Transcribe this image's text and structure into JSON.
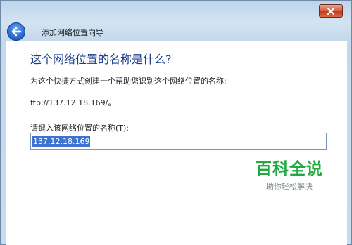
{
  "window": {
    "title": "添加网络位置向导",
    "close_icon": "close-icon",
    "back_icon": "back-arrow-icon"
  },
  "content": {
    "heading": "这个网络位置的名称是什么?",
    "description": "为这个快捷方式创建一个帮助您识别这个网络位置的名称:",
    "url": "ftp://137.12.18.169/。",
    "field_label": "请键入该网络位置的名称(T):",
    "field_value": "137.12.18.169"
  },
  "watermark": {
    "main": "百科全说",
    "sub": "助你轻松解决"
  },
  "colors": {
    "heading": "#1b3f8f",
    "selection": "#3d73d2",
    "watermark": "#1fab3f"
  }
}
